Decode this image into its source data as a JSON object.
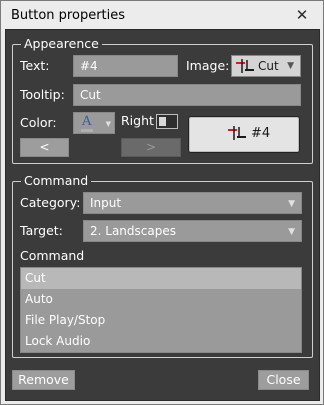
{
  "window": {
    "title": "Button properties",
    "close_glyph": "✕"
  },
  "appearance": {
    "legend": "Appearence",
    "text_label": "Text:",
    "text_value": "#4",
    "image_label": "Image:",
    "image_value": "Cut",
    "tooltip_label": "Tooltip:",
    "tooltip_value": "Cut",
    "color_label": "Color:",
    "color_glyph": "A",
    "right_label": "Right",
    "right_checked": false,
    "prev_label": "<",
    "next_label": ">",
    "preview_text": "#4"
  },
  "command": {
    "legend": "Command",
    "category_label": "Category:",
    "category_value": "Input",
    "target_label": "Target:",
    "target_value": "2. Landscapes",
    "list_label": "Command",
    "items": [
      {
        "label": "Cut",
        "selected": true
      },
      {
        "label": "Auto",
        "selected": false
      },
      {
        "label": "File Play/Stop",
        "selected": false
      },
      {
        "label": "Lock Audio",
        "selected": false
      }
    ]
  },
  "footer": {
    "remove_label": "Remove",
    "close_label": "Close"
  },
  "colors": {
    "panel_bg": "#3b3b3b",
    "field_bg": "#9a9a9a",
    "selected_bg": "#b8b8b8",
    "cut_icon_red": "#cc2222"
  }
}
